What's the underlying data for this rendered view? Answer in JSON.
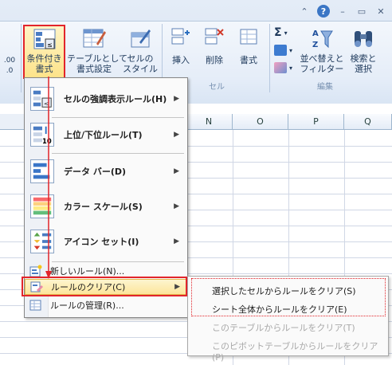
{
  "title_controls": {
    "caret": "⌃",
    "help": "?",
    "minimize": "–",
    "restore": "▭",
    "close": "✕"
  },
  "ribbon": {
    "left_fragment": ".00\n.0",
    "conditional_formatting": "条件付き\n書式",
    "format_as_table": "テーブルとして\n書式設定",
    "cell_styles": "セルの\nスタイル",
    "insert": "挿入",
    "delete": "削除",
    "format": "書式",
    "sort_filter": "並べ替えと\nフィルター",
    "find_select": "検索と\n選択",
    "group_cells": "セル",
    "group_editing": "編集",
    "sigma": "Σ"
  },
  "grid": {
    "columns": [
      "N",
      "O",
      "P",
      "Q"
    ]
  },
  "cf_menu": {
    "items": [
      {
        "label": "セルの強調表示ルール(H)"
      },
      {
        "label": "上位/下位ルール(T)"
      },
      {
        "label": "データ バー(D)"
      },
      {
        "label": "カラー スケール(S)"
      },
      {
        "label": "アイコン セット(I)"
      }
    ],
    "new_rule": "新しいルール(N)...",
    "clear_rules": "ルールのクリア(C)",
    "manage_rules": "ルールの管理(R)...",
    "top10_text": "10"
  },
  "sub_menu": {
    "items": [
      {
        "label": "選択したセルからルールをクリア(S)",
        "enabled": true
      },
      {
        "label": "シート全体からルールをクリア(E)",
        "enabled": true
      },
      {
        "label": "このテーブルからルールをクリア(T)",
        "enabled": false
      },
      {
        "label": "このピボットテーブルからルールをクリア(P)",
        "enabled": false
      }
    ]
  },
  "colors": {
    "highlight": "#fde59b",
    "annotation_red": "#e2252b",
    "ribbon_text": "#1e395b"
  }
}
